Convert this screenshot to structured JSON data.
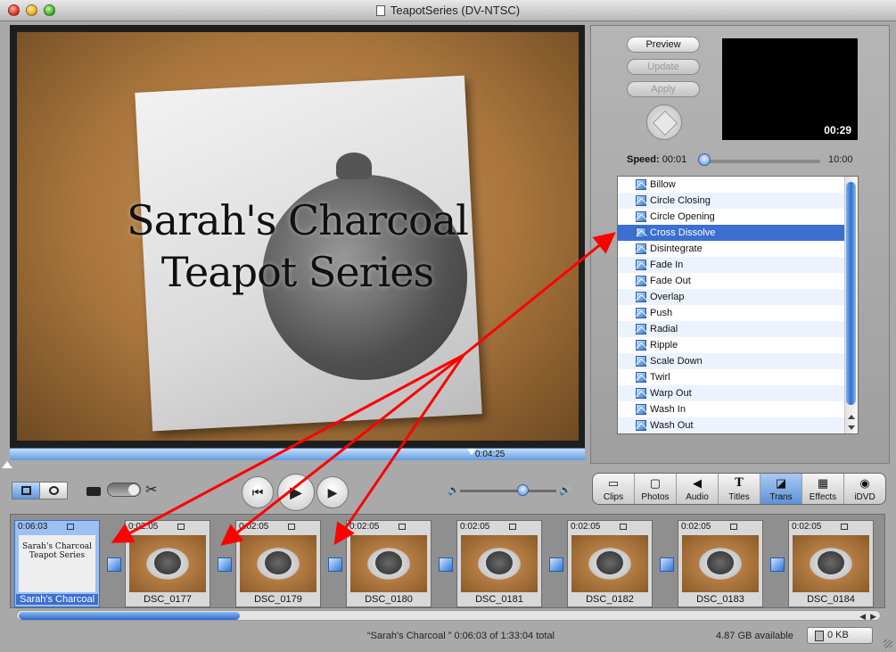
{
  "window": {
    "title": "TeapotSeries (DV-NTSC)"
  },
  "viewer": {
    "overlay_line1": "Sarah's Charcoal",
    "overlay_line2": "Teapot Series",
    "time": "0:04:25"
  },
  "transitions_panel": {
    "preview_label": "Preview",
    "update_label": "Update",
    "apply_label": "Apply",
    "preview_time": "00:29",
    "speed_label": "Speed:",
    "speed_min": "00:01",
    "speed_max": "10:00",
    "speed_value_fraction": 0.04,
    "selected": "Cross Dissolve",
    "items": [
      "Billow",
      "Circle Closing",
      "Circle Opening",
      "Cross Dissolve",
      "Disintegrate",
      "Fade In",
      "Fade Out",
      "Overlap",
      "Push",
      "Radial",
      "Ripple",
      "Scale Down",
      "Twirl",
      "Warp Out",
      "Wash In",
      "Wash Out"
    ]
  },
  "pane_tabs": [
    {
      "label": "Clips",
      "icon": "clips-icon",
      "active": false
    },
    {
      "label": "Photos",
      "icon": "photos-icon",
      "active": false
    },
    {
      "label": "Audio",
      "icon": "audio-icon",
      "active": false
    },
    {
      "label": "Titles",
      "icon": "titles-icon",
      "active": false
    },
    {
      "label": "Trans",
      "icon": "transitions-icon",
      "active": true
    },
    {
      "label": "Effects",
      "icon": "effects-icon",
      "active": false
    },
    {
      "label": "iDVD",
      "icon": "idvd-icon",
      "active": false
    }
  ],
  "timeline": {
    "clips": [
      {
        "duration": "0:06:03",
        "name": "Sarah's Charcoal",
        "selected": true,
        "thumb_text": "Sarah's Charcoal Teapot Series"
      },
      {
        "duration": "0:02:05",
        "name": "DSC_0177",
        "selected": false
      },
      {
        "duration": "0:02:05",
        "name": "DSC_0179",
        "selected": false
      },
      {
        "duration": "0:02:05",
        "name": "DSC_0180",
        "selected": false
      },
      {
        "duration": "0:02:05",
        "name": "DSC_0181",
        "selected": false
      },
      {
        "duration": "0:02:05",
        "name": "DSC_0182",
        "selected": false
      },
      {
        "duration": "0:02:05",
        "name": "DSC_0183",
        "selected": false
      },
      {
        "duration": "0:02:05",
        "name": "DSC_0184",
        "selected": false
      }
    ]
  },
  "status": {
    "clip_info": "“Sarah's Charcoal ” 0:06:03 of 1:33:04 total",
    "disk_available": "4.87 GB available",
    "trash_size": "0 KB"
  },
  "colors": {
    "selection": "#3b6fd1",
    "annotation_arrow": "#ff0000"
  }
}
